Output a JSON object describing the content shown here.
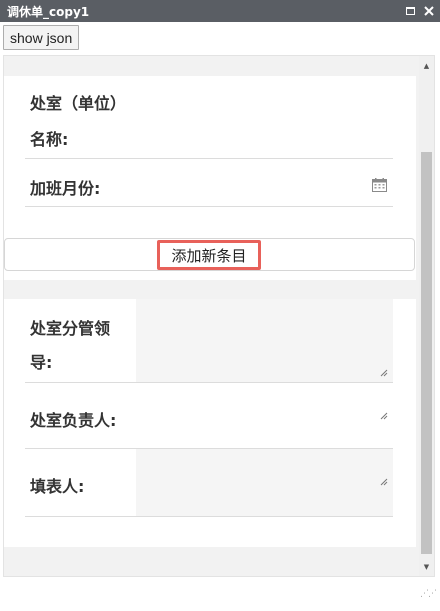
{
  "window": {
    "title": "调休单_copy1",
    "maximize_icon": "maximize-icon",
    "close_icon": "close-icon"
  },
  "toolbar": {
    "show_json_label": "show json"
  },
  "section1": {
    "dept_label_line1": "处室（单位）",
    "dept_label_line2": "名称:",
    "month_label": "加班月份:",
    "calendar_icon": "calendar-icon",
    "add_item_label": "添加新条目"
  },
  "section2": {
    "leader_label_line1": "处室分管领",
    "leader_label_line2": "导:",
    "head_label": "处室负责人:",
    "filler_label": "填表人:"
  },
  "colors": {
    "titlebar_bg": "#5a5e64",
    "highlight_border": "#e8615a",
    "panel_bg": "#f2f2f2"
  }
}
